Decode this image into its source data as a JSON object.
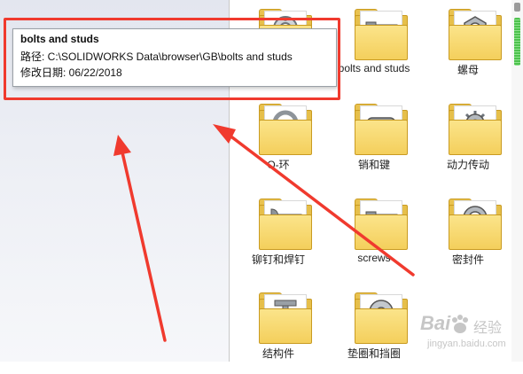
{
  "tooltip": {
    "title": "bolts and studs",
    "path_line": "路径: C:\\SOLIDWORKS Data\\browser\\GB\\bolts and studs",
    "date_line": "修改日期: 06/22/2018"
  },
  "folders": [
    {
      "label": "",
      "icon": "bearing-icon"
    },
    {
      "label": "bolts and studs",
      "icon": "bolt-icon"
    },
    {
      "label": "螺母",
      "icon": "nut-icon"
    },
    {
      "label": "O-环",
      "icon": "o-ring-icon"
    },
    {
      "label": "销和键",
      "icon": "pin-icon"
    },
    {
      "label": "动力传动",
      "icon": "gear-icon"
    },
    {
      "label": "铆钉和焊钉",
      "icon": "rivet-icon"
    },
    {
      "label": "screws",
      "icon": "screw-icon"
    },
    {
      "label": "密封件",
      "icon": "seal-icon"
    },
    {
      "label": "结构件",
      "icon": "i-beam-icon"
    },
    {
      "label": "垫圈和挡圈",
      "icon": "washer-icon"
    }
  ],
  "watermark": {
    "logo": "Bai",
    "suffix": "经验",
    "url": "jingyan.baidu.com"
  },
  "colors": {
    "annotation_red": "#f03a2e",
    "folder_yellow": "#f4cf5c",
    "scroll_green": "#4ec24e"
  }
}
